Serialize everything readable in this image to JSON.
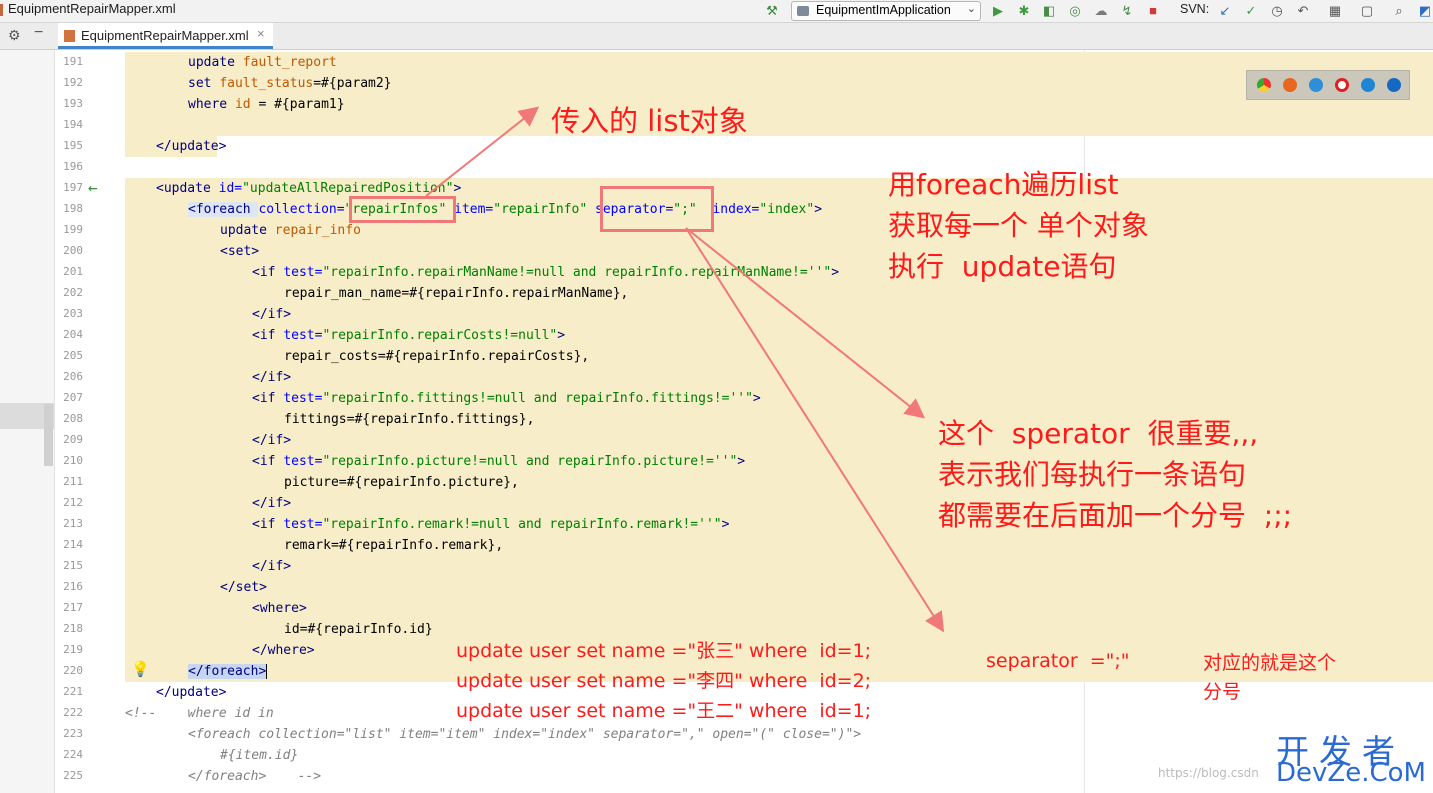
{
  "window": {
    "file_title": "EquipmentRepairMapper.xml"
  },
  "toolbar": {
    "run_config": "EquipmentImApplication",
    "svn_label": "SVN:"
  },
  "tabs": [
    {
      "label": "EquipmentRepairMapper.xml"
    }
  ],
  "editor": {
    "lines": [
      {
        "n": "191"
      },
      {
        "n": "192"
      },
      {
        "n": "193"
      },
      {
        "n": "194"
      },
      {
        "n": "195"
      },
      {
        "n": "196"
      },
      {
        "n": "197"
      },
      {
        "n": "198"
      },
      {
        "n": "199"
      },
      {
        "n": "200"
      },
      {
        "n": "201"
      },
      {
        "n": "202"
      },
      {
        "n": "203"
      },
      {
        "n": "204"
      },
      {
        "n": "205"
      },
      {
        "n": "206"
      },
      {
        "n": "207"
      },
      {
        "n": "208"
      },
      {
        "n": "209"
      },
      {
        "n": "210"
      },
      {
        "n": "211"
      },
      {
        "n": "212"
      },
      {
        "n": "213"
      },
      {
        "n": "214"
      },
      {
        "n": "215"
      },
      {
        "n": "216"
      },
      {
        "n": "217"
      },
      {
        "n": "218"
      },
      {
        "n": "219"
      },
      {
        "n": "220"
      },
      {
        "n": "221"
      },
      {
        "n": "222"
      },
      {
        "n": "223"
      },
      {
        "n": "224"
      },
      {
        "n": "225"
      }
    ],
    "code": {
      "l191a": "update ",
      "l191b": "fault_report",
      "l192a": "set ",
      "l192b": "fault_status",
      "l192c": "=#{param2}",
      "l193a": "where ",
      "l193b": "id",
      "l193c": " = #{param1}",
      "l195": "</update>",
      "l197a": "<update ",
      "l197b": "id=",
      "l197c": "\"updateAllRepairedPosition\"",
      "l197d": ">",
      "l198a": "<foreach ",
      "l198b": "collection=",
      "l198c": "\"repairInfos\"",
      "l198d": " item=",
      "l198e": "\"repairInfo\"",
      "l198f": " separator=",
      "l198g": "\";\"",
      "l198h": "  index=",
      "l198i": "\"index\"",
      "l198j": ">",
      "l199a": "update ",
      "l199b": "repair_info",
      "l200": "<set>",
      "l201a": "<if ",
      "l201b": "test=",
      "l201c": "\"repairInfo.repairManName!=null and repairInfo.repairManName!=''\"",
      "l201d": ">",
      "l202": "repair_man_name=#{repairInfo.repairManName},",
      "l203": "</if>",
      "l204a": "<if ",
      "l204b": "test=",
      "l204c": "\"repairInfo.repairCosts!=null\"",
      "l204d": ">",
      "l205": "repair_costs=#{repairInfo.repairCosts},",
      "l206": "</if>",
      "l207a": "<if ",
      "l207b": "test=",
      "l207c": "\"repairInfo.fittings!=null and repairInfo.fittings!=''\"",
      "l207d": ">",
      "l208": "fittings=#{repairInfo.fittings},",
      "l209": "</if>",
      "l210a": "<if ",
      "l210b": "test=",
      "l210c": "\"repairInfo.picture!=null and repairInfo.picture!=''\"",
      "l210d": ">",
      "l211": "picture=#{repairInfo.picture},",
      "l212": "</if>",
      "l213a": "<if ",
      "l213b": "test=",
      "l213c": "\"repairInfo.remark!=null and repairInfo.remark!=''\"",
      "l213d": ">",
      "l214": "remark=#{repairInfo.remark},",
      "l215": "</if>",
      "l216": "</set>",
      "l217": "<where>",
      "l218": "id=#{repairInfo.id}",
      "l219": "</where>",
      "l220": "</foreach>",
      "l221": "</update>",
      "l222": "<!--    where id in",
      "l223": "<foreach collection=\"list\" item=\"item\" index=\"index\" separator=\",\" open=\"(\" close=\")\">",
      "l224": "#{item.id}",
      "l225": "</foreach>    -->"
    }
  },
  "annotations": {
    "list_object": "传入的 list对象",
    "foreach_note": [
      "用foreach遍历list",
      "获取每一个 单个对象",
      "执行  update语句"
    ],
    "separator_note": [
      "这个  sperator  很重要,,,",
      "表示我们每执行一条语句",
      "都需要在后面加一个分号  ;;;"
    ],
    "sql_examples": [
      "update user set name =\"张三\" where  id=1;",
      "update user set name =\"李四\" where  id=2;",
      "update user set name =\"王二\" where  id=1;"
    ],
    "separator_eq": "separator  =\";\"",
    "corresponds": [
      "对应的就是这个",
      "分号"
    ]
  },
  "watermark": {
    "line1": "开发者",
    "line2": "DevZe.CoM",
    "url": "https://blog.csdn"
  },
  "colors": {
    "highlight": "#f7edc9",
    "annotation_red": "#ff1a1a",
    "tab_underline": "#4083c9"
  }
}
